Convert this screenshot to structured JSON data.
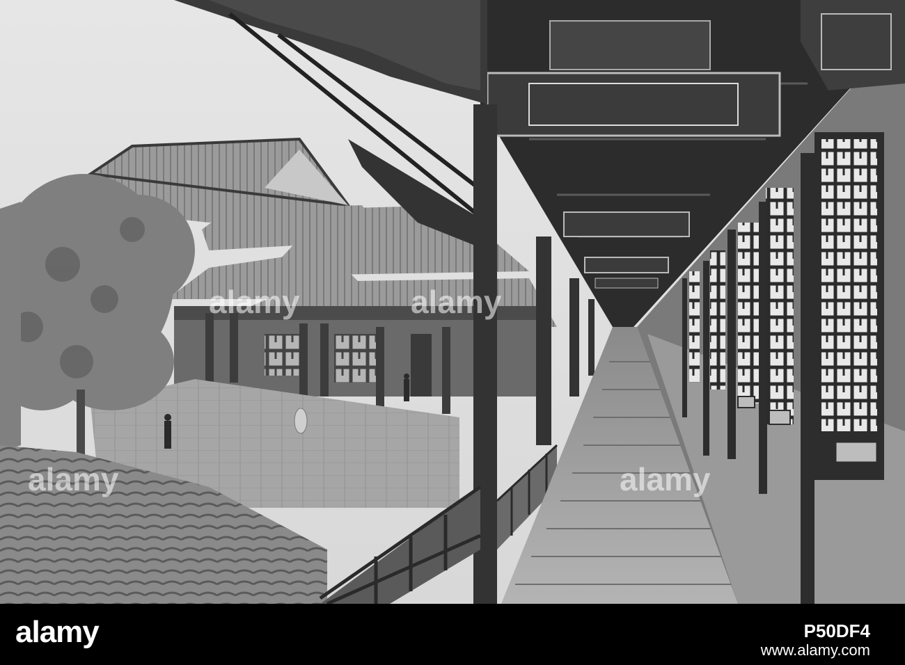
{
  "photo": {
    "subject": "covered-corridor-staircase-monochrome"
  },
  "watermark": {
    "text": "alamy"
  },
  "footer": {
    "brand": "alamy",
    "image_id": "P50DF4",
    "url": "www.alamy.com",
    "background": "#000000",
    "text_color": "#ffffff"
  }
}
